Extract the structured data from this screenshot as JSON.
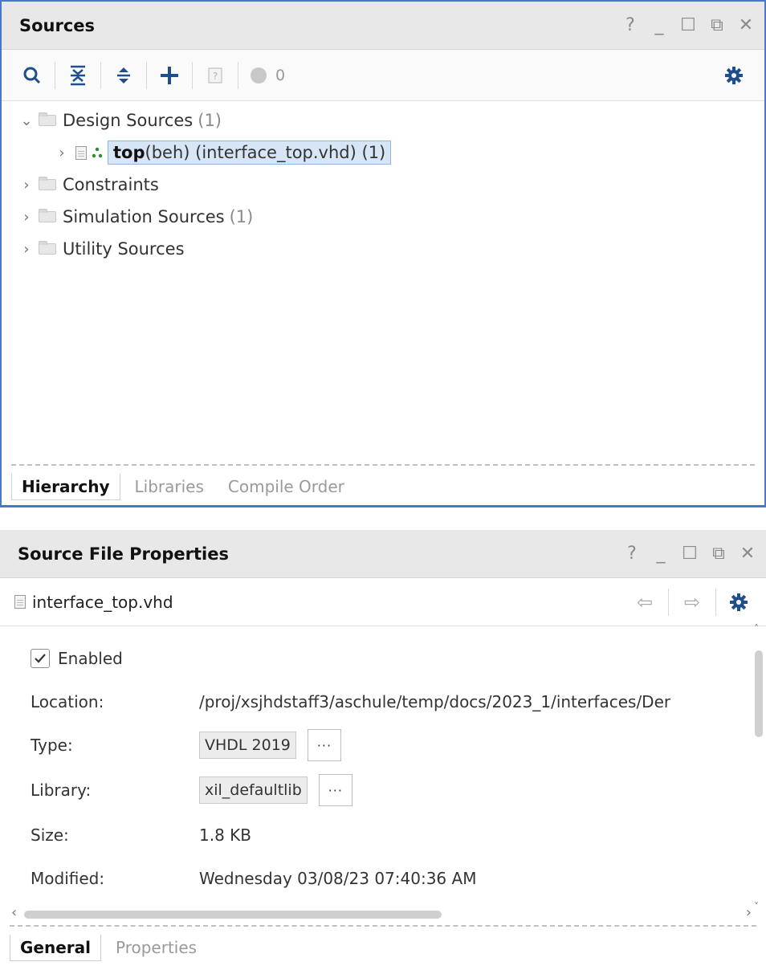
{
  "sources": {
    "title": "Sources",
    "window_controls": [
      "?",
      "_",
      "☐",
      "⧉",
      "✕"
    ],
    "toolbar": {
      "badge_count": "0"
    },
    "tree": {
      "design_sources": {
        "label": "Design Sources",
        "count": "(1)"
      },
      "top": {
        "name": "top",
        "detail": "(beh) (interface_top.vhd) (1)"
      },
      "constraints": {
        "label": "Constraints"
      },
      "simulation": {
        "label": "Simulation Sources",
        "count": "(1)"
      },
      "utility": {
        "label": "Utility Sources"
      }
    },
    "tabs": [
      "Hierarchy",
      "Libraries",
      "Compile Order"
    ]
  },
  "properties": {
    "title": "Source File Properties",
    "window_controls": [
      "?",
      "_",
      "☐",
      "⧉",
      "✕"
    ],
    "file_name": "interface_top.vhd",
    "enabled_label": "Enabled",
    "location": {
      "label": "Location:",
      "value": "/proj/xsjhdstaff3/aschule/temp/docs/2023_1/interfaces/Der"
    },
    "type": {
      "label": "Type:",
      "value": "VHDL 2019"
    },
    "library": {
      "label": "Library:",
      "value": "xil_defaultlib"
    },
    "size": {
      "label": "Size:",
      "value": "1.8 KB"
    },
    "modified": {
      "label": "Modified:",
      "value": "Wednesday 03/08/23 07:40:36 AM"
    },
    "dots_label": "···",
    "tabs": [
      "General",
      "Properties"
    ]
  }
}
